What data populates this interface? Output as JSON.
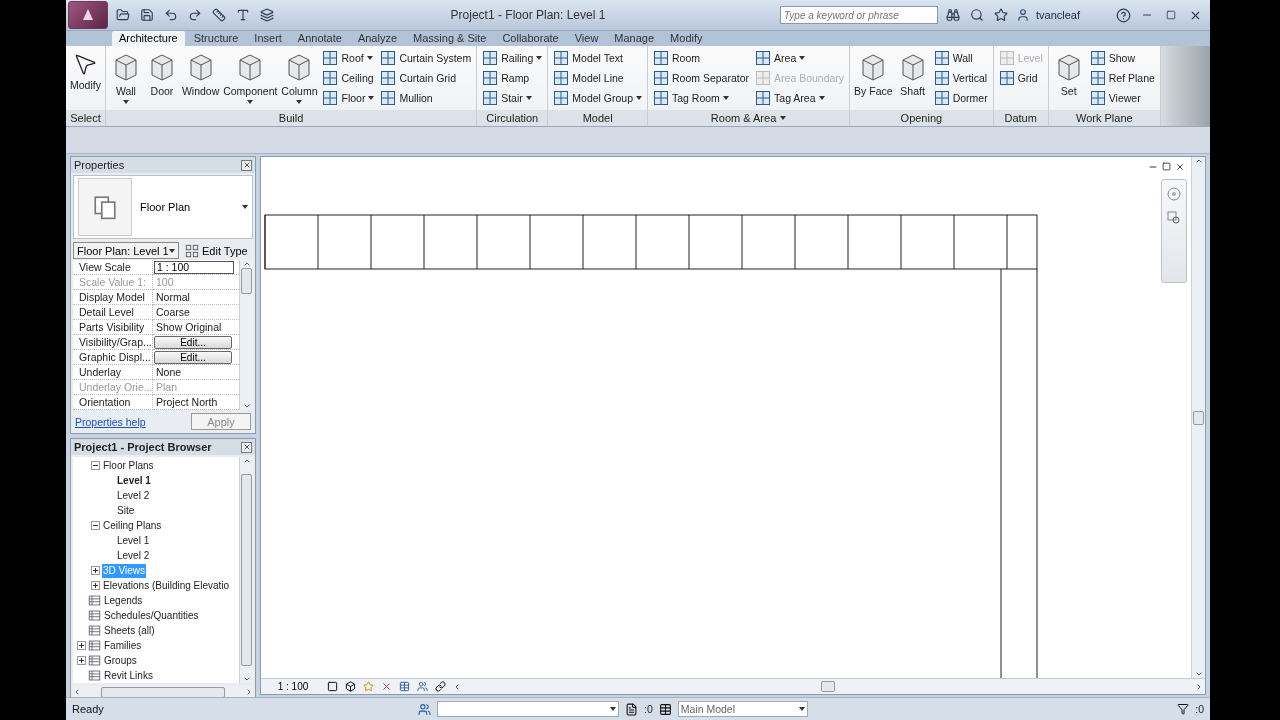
{
  "app": {
    "title": "Project1 - Floor Plan: Level 1",
    "search_placeholder": "Type a keyword or phrase",
    "user": "tvancleaf"
  },
  "tabs": [
    {
      "label": "Architecture",
      "selected": true
    },
    {
      "label": "Structure",
      "selected": false
    },
    {
      "label": "Insert",
      "selected": false
    },
    {
      "label": "Annotate",
      "selected": false
    },
    {
      "label": "Analyze",
      "selected": false
    },
    {
      "label": "Massing & Site",
      "selected": false
    },
    {
      "label": "Collaborate",
      "selected": false
    },
    {
      "label": "View",
      "selected": false
    },
    {
      "label": "Manage",
      "selected": false
    },
    {
      "label": "Modify",
      "selected": false
    }
  ],
  "ribbon": [
    {
      "title": "Select",
      "menu": false,
      "tools": [
        {
          "label": "Modify",
          "kind": "large",
          "dropdown": false,
          "disabled": false
        }
      ]
    },
    {
      "title": "Build",
      "menu": false,
      "tools": [
        {
          "label": "Wall",
          "kind": "large",
          "dropdown": true,
          "disabled": false
        },
        {
          "label": "Door",
          "kind": "large",
          "dropdown": false,
          "disabled": false
        },
        {
          "label": "Window",
          "kind": "large",
          "dropdown": false,
          "disabled": false
        },
        {
          "label": "Component",
          "kind": "large",
          "dropdown": true,
          "disabled": false
        },
        {
          "label": "Column",
          "kind": "large",
          "dropdown": true,
          "disabled": false
        },
        {
          "label": "Roof",
          "kind": "small",
          "dropdown": true,
          "disabled": false
        },
        {
          "label": "Ceiling",
          "kind": "small",
          "dropdown": false,
          "disabled": false
        },
        {
          "label": "Floor",
          "kind": "small",
          "dropdown": true,
          "disabled": false
        },
        {
          "label": "Curtain System",
          "kind": "small",
          "dropdown": false,
          "disabled": false
        },
        {
          "label": "Curtain Grid",
          "kind": "small",
          "dropdown": false,
          "disabled": false
        },
        {
          "label": "Mullion",
          "kind": "small",
          "dropdown": false,
          "disabled": false
        }
      ]
    },
    {
      "title": "Circulation",
      "menu": false,
      "tools": [
        {
          "label": "Railing",
          "kind": "small",
          "dropdown": true,
          "disabled": false
        },
        {
          "label": "Ramp",
          "kind": "small",
          "dropdown": false,
          "disabled": false
        },
        {
          "label": "Stair",
          "kind": "small",
          "dropdown": true,
          "disabled": false
        }
      ]
    },
    {
      "title": "Model",
      "menu": false,
      "tools": [
        {
          "label": "Model Text",
          "kind": "small",
          "dropdown": false,
          "disabled": false
        },
        {
          "label": "Model Line",
          "kind": "small",
          "dropdown": false,
          "disabled": false
        },
        {
          "label": "Model Group",
          "kind": "small",
          "dropdown": true,
          "disabled": false
        }
      ]
    },
    {
      "title": "Room & Area",
      "menu": true,
      "tools": [
        {
          "label": "Room",
          "kind": "small",
          "dropdown": false,
          "disabled": false
        },
        {
          "label": "Room Separator",
          "kind": "small",
          "dropdown": false,
          "disabled": false
        },
        {
          "label": "Tag Room",
          "kind": "small",
          "dropdown": true,
          "disabled": false
        },
        {
          "label": "Area",
          "kind": "small",
          "dropdown": true,
          "disabled": false
        },
        {
          "label": "Area Boundary",
          "kind": "small",
          "dropdown": false,
          "disabled": true
        },
        {
          "label": "Tag Area",
          "kind": "small",
          "dropdown": true,
          "disabled": false
        }
      ]
    },
    {
      "title": "Opening",
      "menu": false,
      "tools": [
        {
          "label": "By Face",
          "kind": "large",
          "dropdown": false,
          "disabled": false
        },
        {
          "label": "Shaft",
          "kind": "large",
          "dropdown": false,
          "disabled": false
        },
        {
          "label": "Wall",
          "kind": "small",
          "dropdown": false,
          "disabled": false
        },
        {
          "label": "Vertical",
          "kind": "small",
          "dropdown": false,
          "disabled": false
        },
        {
          "label": "Dormer",
          "kind": "small",
          "dropdown": false,
          "disabled": false
        }
      ]
    },
    {
      "title": "Datum",
      "menu": false,
      "tools": [
        {
          "label": "Level",
          "kind": "small",
          "dropdown": false,
          "disabled": true
        },
        {
          "label": "Grid",
          "kind": "small",
          "dropdown": false,
          "disabled": false
        }
      ]
    },
    {
      "title": "Work Plane",
      "menu": false,
      "tools": [
        {
          "label": "Set",
          "kind": "large",
          "dropdown": false,
          "disabled": false
        },
        {
          "label": "Show",
          "kind": "small",
          "dropdown": false,
          "disabled": false
        },
        {
          "label": "Ref Plane",
          "kind": "small",
          "dropdown": false,
          "disabled": false
        },
        {
          "label": "Viewer",
          "kind": "small",
          "dropdown": false,
          "disabled": false
        }
      ]
    }
  ],
  "properties": {
    "title": "Properties",
    "type_name": "Floor Plan",
    "instance": "Floor Plan: Level 1",
    "edit_type": "Edit Type",
    "rows": [
      {
        "label": "View Scale",
        "value": "1 : 100",
        "kind": "field",
        "disabled": false
      },
      {
        "label": "Scale Value    1:",
        "value": "100",
        "kind": "text",
        "disabled": true
      },
      {
        "label": "Display Model",
        "value": "Normal",
        "kind": "text",
        "disabled": false
      },
      {
        "label": "Detail Level",
        "value": "Coarse",
        "kind": "text",
        "disabled": false
      },
      {
        "label": "Parts Visibility",
        "value": "Show Original",
        "kind": "text",
        "disabled": false
      },
      {
        "label": "Visibility/Grap...",
        "value": "Edit...",
        "kind": "button",
        "disabled": false
      },
      {
        "label": "Graphic Displ...",
        "value": "Edit...",
        "kind": "button",
        "disabled": false
      },
      {
        "label": "Underlay",
        "value": "None",
        "kind": "text",
        "disabled": false
      },
      {
        "label": "Underlay Orie...",
        "value": "Plan",
        "kind": "text",
        "disabled": true
      },
      {
        "label": "Orientation",
        "value": "Project North",
        "kind": "text",
        "disabled": false
      }
    ],
    "help": "Properties help",
    "apply": "Apply"
  },
  "browser": {
    "title": "Project1 - Project Browser",
    "view_nodes": [
      {
        "label": "Floor Plans",
        "expanded": true,
        "selected": false,
        "children": [
          {
            "label": "Level 1",
            "current": true,
            "selected": false
          },
          {
            "label": "Level 2",
            "current": false,
            "selected": false
          },
          {
            "label": "Site",
            "current": false,
            "selected": false
          }
        ]
      },
      {
        "label": "Ceiling Plans",
        "expanded": true,
        "selected": false,
        "children": [
          {
            "label": "Level 1",
            "current": false,
            "selected": false
          },
          {
            "label": "Level 2",
            "current": false,
            "selected": false
          }
        ]
      },
      {
        "label": "3D Views",
        "expanded": false,
        "selected": true
      },
      {
        "label": "Elevations (Building Elevatio",
        "expanded": false,
        "selected": false
      }
    ],
    "nodes": [
      {
        "label": "Legends",
        "selected": false
      },
      {
        "label": "Schedules/Quantities",
        "selected": false
      },
      {
        "label": "Sheets (all)",
        "selected": false
      },
      {
        "label": "Families",
        "expanded": false,
        "selected": false
      },
      {
        "label": "Groups",
        "expanded": false,
        "selected": false
      },
      {
        "label": "Revit Links",
        "selected": false
      }
    ]
  },
  "view_bar": {
    "scale": "1 : 100"
  },
  "status": {
    "text": "Ready",
    "editable_count": ":0",
    "model": "Main Model",
    "filter_count": ":0"
  }
}
